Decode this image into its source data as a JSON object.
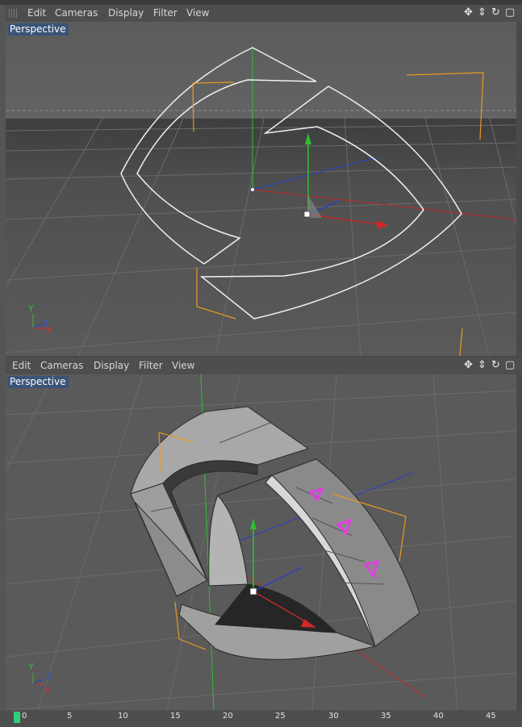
{
  "top_viewport": {
    "menu": [
      "Edit",
      "Cameras",
      "Display",
      "Filter",
      "View"
    ],
    "label": "Perspective",
    "nav_icons": [
      "move-icon",
      "zoom-icon",
      "rotate-icon",
      "maximize-icon"
    ]
  },
  "bottom_viewport": {
    "menu": [
      "Edit",
      "Cameras",
      "Display",
      "Filter",
      "View"
    ],
    "label": "Perspective",
    "nav_icons": [
      "move-icon",
      "zoom-icon",
      "rotate-icon",
      "maximize-icon"
    ]
  },
  "axes_gizmo": {
    "y": "Y",
    "z": "Z",
    "x": "X"
  },
  "timeline": {
    "current_frame": "0",
    "ticks": [
      "5",
      "10",
      "15",
      "20",
      "25",
      "30",
      "35",
      "40",
      "45"
    ]
  },
  "colors": {
    "x_axis": "#d23030",
    "y_axis": "#2fbf2f",
    "z_axis": "#2a3fc8",
    "selection": "#f0a020",
    "point_highlight": "#e040e0",
    "viewport_label_bg": "#3a5478"
  }
}
